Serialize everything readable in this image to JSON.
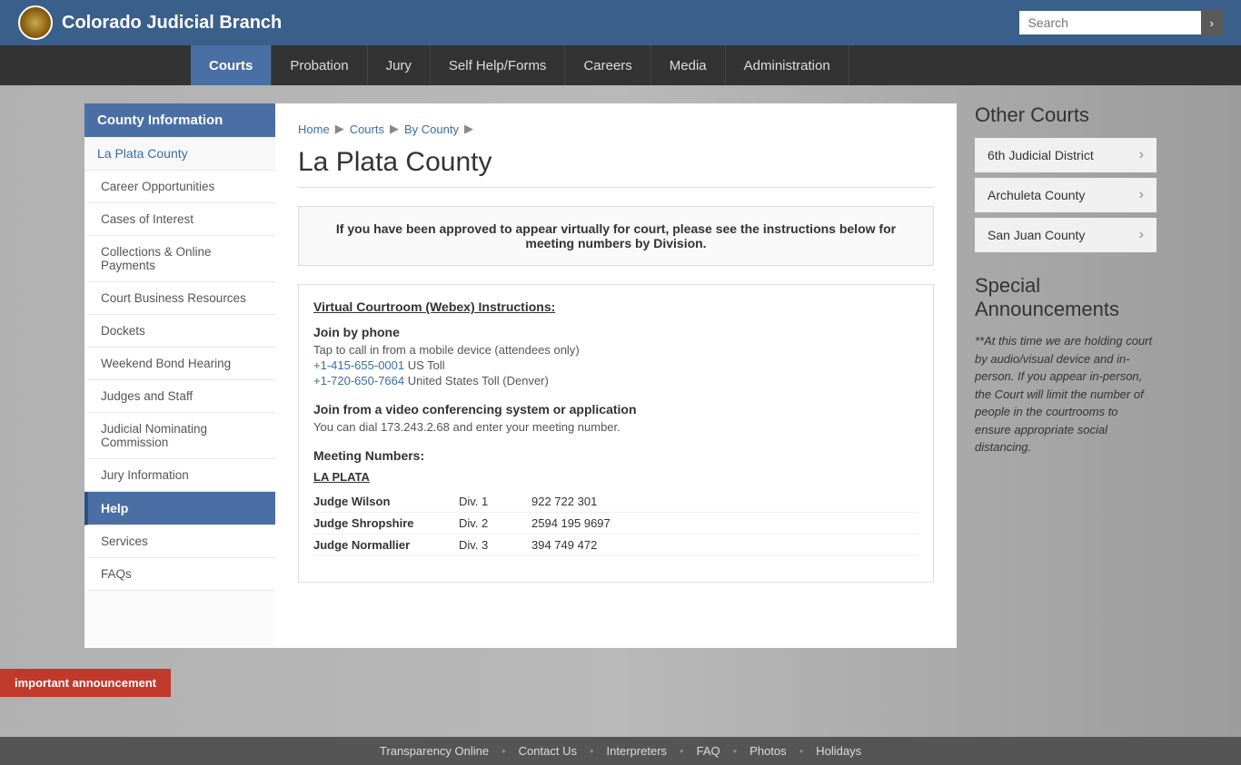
{
  "header": {
    "site_title": "Colorado Judicial Branch",
    "search_placeholder": "Search",
    "search_btn_label": "›"
  },
  "nav": {
    "items": [
      {
        "label": "Courts",
        "active": true
      },
      {
        "label": "Probation",
        "active": false
      },
      {
        "label": "Jury",
        "active": false
      },
      {
        "label": "Self Help/Forms",
        "active": false
      },
      {
        "label": "Careers",
        "active": false
      },
      {
        "label": "Media",
        "active": false
      },
      {
        "label": "Administration",
        "active": false
      }
    ]
  },
  "sidebar": {
    "title": "County Information",
    "items": [
      {
        "label": "La Plata County",
        "type": "la-plata"
      },
      {
        "label": "Career Opportunities",
        "type": "sub"
      },
      {
        "label": "Cases of Interest",
        "type": "sub"
      },
      {
        "label": "Collections & Online Payments",
        "type": "sub"
      },
      {
        "label": "Court Business Resources",
        "type": "sub"
      },
      {
        "label": "Dockets",
        "type": "sub"
      },
      {
        "label": "Weekend Bond Hearing",
        "type": "sub"
      },
      {
        "label": "Judges and Staff",
        "type": "sub"
      },
      {
        "label": "Judicial Nominating Commission",
        "type": "sub"
      },
      {
        "label": "Jury Information",
        "type": "sub"
      },
      {
        "label": "Help",
        "type": "active"
      },
      {
        "label": "Services",
        "type": "sub"
      },
      {
        "label": "FAQs",
        "type": "sub"
      }
    ]
  },
  "breadcrumb": {
    "home": "Home",
    "courts": "Courts",
    "by_county": "By County"
  },
  "main": {
    "page_title": "La Plata County",
    "virtual_notice": "If you have been approved to appear virtually for court, please see the instructions below for meeting numbers by Division.",
    "instructions_heading": "Virtual Courtroom (Webex) Instructions:",
    "join_phone_heading": "Join by phone",
    "join_phone_text": "Tap to call in from a mobile device (attendees only)",
    "phone1": "+1-415-655-0001",
    "phone1_label": "US Toll",
    "phone2": "+1-720-650-7664",
    "phone2_label": "United States Toll (Denver)",
    "join_video_heading": "Join from a video conferencing system or application",
    "join_video_text": "You can dial 173.243.2.68 and enter your meeting number.",
    "meeting_heading": "Meeting Numbers:",
    "la_plata_label": "LA PLATA",
    "judges": [
      {
        "name": "Judge Wilson",
        "div": "Div. 1",
        "num": "922 722 301"
      },
      {
        "name": "Judge Shropshire",
        "div": "Div. 2",
        "num": "2594 195 9697"
      },
      {
        "name": "Judge Normallier",
        "div": "Div. 3",
        "num": "394 749 472"
      }
    ]
  },
  "right_sidebar": {
    "other_courts_heading": "Other Courts",
    "courts": [
      {
        "label": "6th Judicial District"
      },
      {
        "label": "Archuleta County"
      },
      {
        "label": "San Juan County"
      }
    ],
    "announcements_heading": "Special Announcements",
    "announcement_text": "**At this time we are holding court by audio/visual device and in-person.  If you appear in-person, the Court will limit the number of people in the courtrooms to ensure appropriate social distancing."
  },
  "footer": {
    "links": [
      {
        "label": "Transparency Online"
      },
      {
        "label": "Contact Us"
      },
      {
        "label": "Interpreters"
      },
      {
        "label": "FAQ"
      },
      {
        "label": "Photos"
      },
      {
        "label": "Holidays"
      }
    ]
  },
  "important_bar": {
    "label": "important announcement"
  }
}
